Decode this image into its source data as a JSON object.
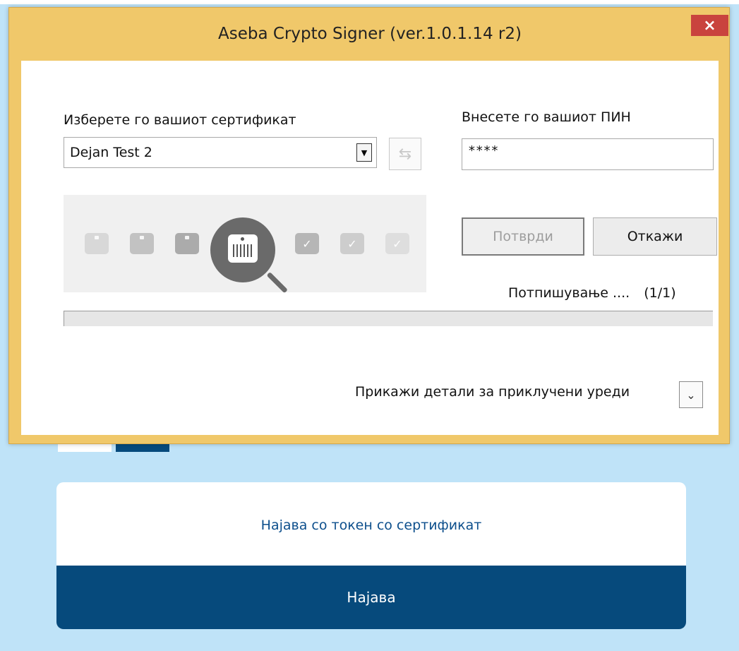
{
  "window": {
    "title": "Aseba Crypto Signer (ver.1.0.1.14 r2)",
    "close_symbol": "×",
    "title_bar_color": "#f0c86a"
  },
  "certificate": {
    "label": "Изберете го вашиот сертификат",
    "selected": "Dejan Test 2",
    "dropdown_icon": "chevron-down-icon",
    "refresh_icon": "refresh-icon"
  },
  "pin": {
    "label": "Внесете го вашиот ПИН",
    "value": "****"
  },
  "devices": {
    "items": [
      {
        "icon": "token-icon",
        "color": "#d8d8d8",
        "checked": false
      },
      {
        "icon": "token-icon",
        "color": "#c2c2c2",
        "checked": false
      },
      {
        "icon": "token-icon",
        "color": "#ababab",
        "checked": false
      },
      {
        "icon": "token-icon",
        "color": "#9d9d9d",
        "checked": true
      },
      {
        "icon": "token-icon",
        "color": "#b6b6b6",
        "checked": true
      },
      {
        "icon": "token-icon",
        "color": "#cdcdcd",
        "checked": true
      },
      {
        "icon": "token-icon",
        "color": "#dedede",
        "checked": true
      }
    ],
    "search_icon": "magnifier-token-icon"
  },
  "buttons": {
    "confirm": "Потврди",
    "cancel": "Откажи"
  },
  "progress": {
    "label": "Потпишување ....",
    "count": "(1/1)",
    "fraction": 0.0
  },
  "details": {
    "label": "Прикажи детали за приклучени уреди",
    "expand_symbol": "≽"
  },
  "background_page": {
    "token_login_text": "Најава со токен со сертификат",
    "login_button": "Најава",
    "brand_color": "#064a7c",
    "background_color": "#bfe3f8"
  }
}
